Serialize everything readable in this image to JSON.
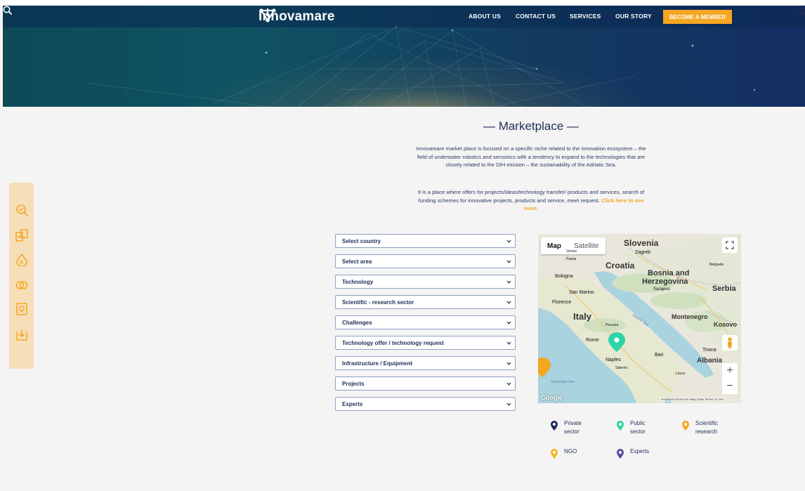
{
  "header": {
    "logo_text": "Innovamare",
    "nav": [
      "ABOUT US",
      "CONTACT US",
      "SERVICES",
      "OUR STORY"
    ],
    "cta": "BECOME A MEMBER"
  },
  "main": {
    "title": "— Marketplace —",
    "intro": "Innovamare market place is focused on a specific niche related to the innovation ecosystem – the field of underwater robotics and sensorics with a tendency to expand to the technologies that are closely related to the DIH mission – the sustainability of the Adriatic Sea.",
    "intro2_text": "It is a place where offers for projects/ideas/technology transfer/ products and services, search of funding schemes for innovative projects, products and service, meet request.",
    "intro2_link": "Click here to see more."
  },
  "filters": [
    "Select country",
    "Select area",
    "Technology",
    "Scientific - research sector",
    "Challenges",
    "Technology offer / technology request",
    "Infrastructure / Equipment",
    "Projects",
    "Experts"
  ],
  "map": {
    "tab_map": "Map",
    "tab_satellite": "Satellite",
    "labels": {
      "slovenia": "Slovenia",
      "zagreb": "Zagreb",
      "croatia": "Croatia",
      "bosnia": "Bosnia and",
      "herzegovina": "Herzegovina",
      "serbia": "Serbia",
      "sarajevo": "Sarajevo",
      "belgrade": "Belgrade",
      "bologna": "Bologna",
      "san_marino": "San Marino",
      "florence": "Florence",
      "italy": "Italy",
      "montenegro": "Montenegro",
      "kosovo": "Kosovo",
      "pescara": "Pescara",
      "rome": "Rome",
      "naples": "Naples",
      "bari": "Bari",
      "tirana": "Tirana",
      "albania": "Albania",
      "tyrrhenian": "Tyrrhenian Sea",
      "adriatic": "Adriatic Sea",
      "padua": "Padua",
      "venice": "Venice",
      "salerno": "Salerno",
      "lecce": "Lecce"
    },
    "footer": "Keyboard shortcuts  Map Data  Terms of Use",
    "google": "Google",
    "zoom_in": "+",
    "zoom_out": "−"
  },
  "legend": [
    {
      "label": "Private\nsector",
      "color": "#1f2d5a"
    },
    {
      "label": "Public\nsector",
      "color": "#2fd3a8"
    },
    {
      "label": "Scientific\nresearch",
      "color": "#f5a623"
    },
    {
      "label": "NGO",
      "color": "#f5b62a"
    },
    {
      "label": "Experts",
      "color": "#5a4aa0"
    }
  ],
  "colors": {
    "accent": "#f5a623",
    "navy": "#1f2d5a",
    "side_panel": "#f6deb8"
  },
  "side_icons": [
    "search-check-icon",
    "transfer-icon",
    "funding-drop-icon",
    "rings-icon",
    "idea-document-icon",
    "download-box-icon"
  ]
}
